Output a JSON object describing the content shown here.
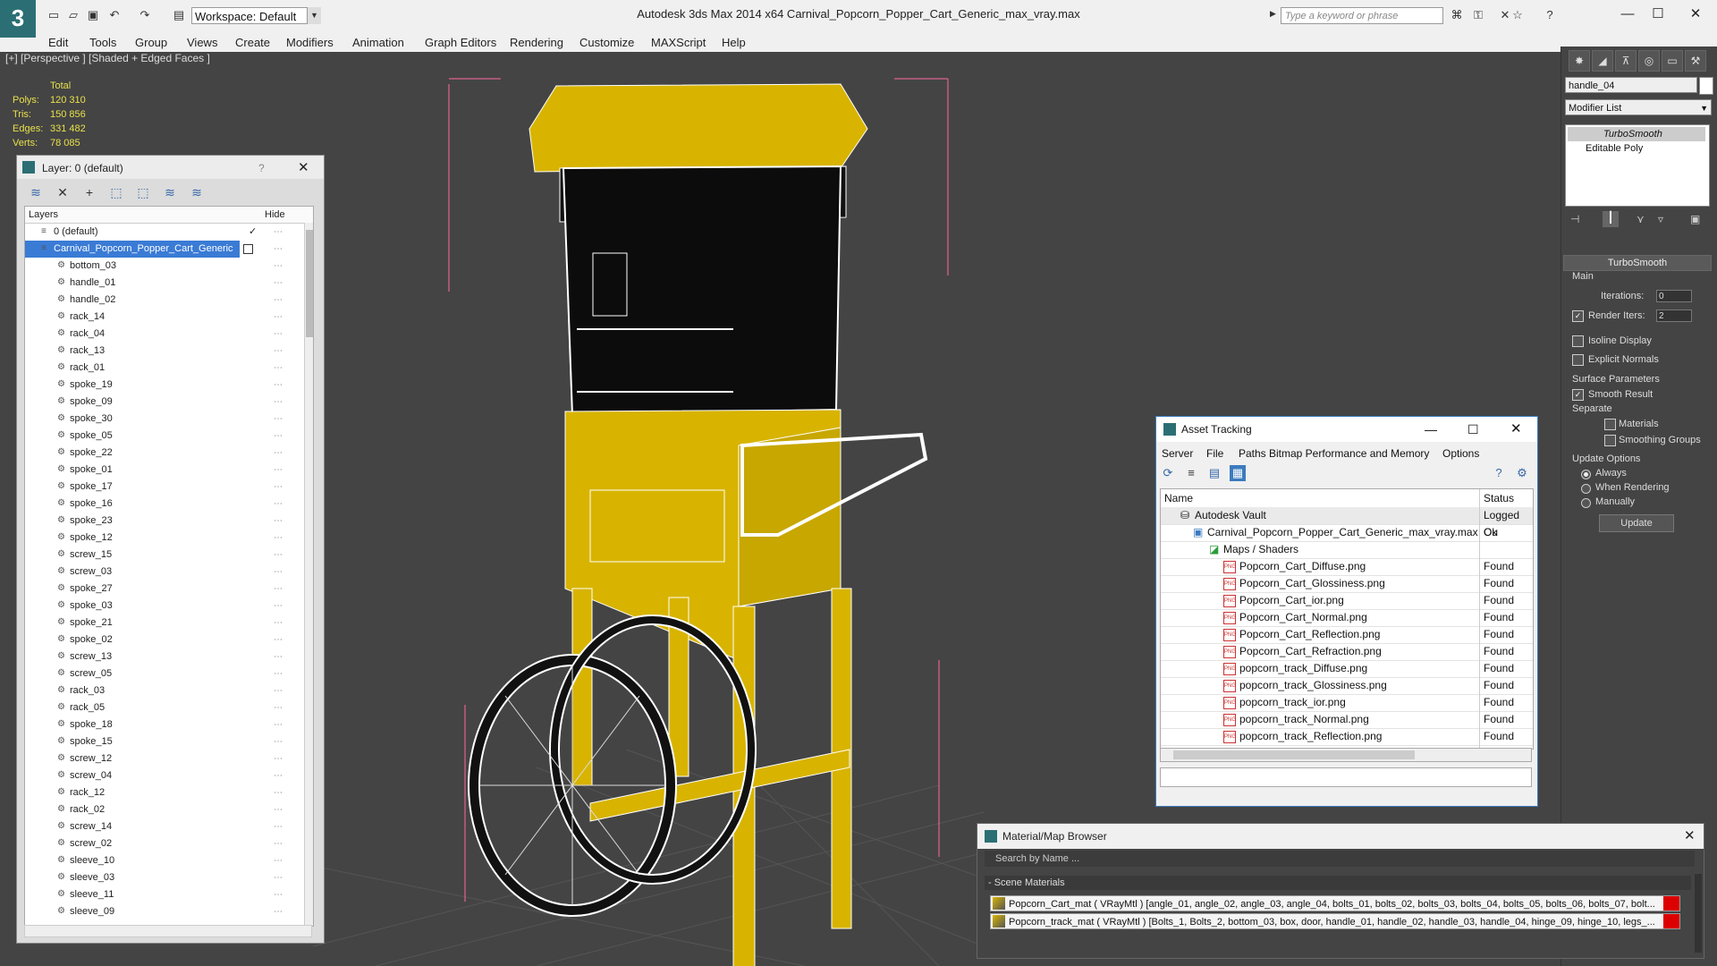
{
  "titlebar": {
    "workspace": "Workspace: Default",
    "title": "Autodesk 3ds Max  2014 x64     Carnival_Popcorn_Popper_Cart_Generic_max_vray.max",
    "search_placeholder": "Type a keyword or phrase"
  },
  "menu": [
    "Edit",
    "Tools",
    "Group",
    "Views",
    "Create",
    "Modifiers",
    "Animation",
    "Graph Editors",
    "Rendering",
    "Customize",
    "MAXScript",
    "Help"
  ],
  "viewport": {
    "label": "[+] [Perspective ] [Shaded + Edged Faces ]",
    "stats": {
      "header": "Total",
      "polys_label": "Polys:",
      "polys": "120 310",
      "tris_label": "Tris:",
      "tris": "150 856",
      "edges_label": "Edges:",
      "edges": "331 482",
      "verts_label": "Verts:",
      "verts": "78 085"
    }
  },
  "layer_dialog": {
    "title": "Layer: 0 (default)",
    "help": "?",
    "col_layers": "Layers",
    "col_hide": "Hide",
    "rows": [
      "0 (default)",
      "Carnival_Popcorn_Popper_Cart_Generic",
      "bottom_03",
      "handle_01",
      "handle_02",
      "rack_14",
      "rack_04",
      "rack_13",
      "rack_01",
      "spoke_19",
      "spoke_09",
      "spoke_30",
      "spoke_05",
      "spoke_22",
      "spoke_01",
      "spoke_17",
      "spoke_16",
      "spoke_23",
      "spoke_12",
      "screw_15",
      "screw_03",
      "spoke_27",
      "spoke_03",
      "spoke_21",
      "spoke_02",
      "screw_13",
      "screw_05",
      "rack_03",
      "rack_05",
      "spoke_18",
      "spoke_15",
      "screw_12",
      "screw_04",
      "rack_12",
      "rack_02",
      "screw_14",
      "screw_02",
      "sleeve_10",
      "sleeve_03",
      "sleeve_11",
      "sleeve_09"
    ]
  },
  "command_panel": {
    "object_name": "handle_04",
    "modifier_list": "Modifier List",
    "stack": [
      "TurboSmooth",
      "Editable Poly"
    ],
    "rollout_title": "TurboSmooth",
    "main": "Main",
    "iterations_label": "Iterations:",
    "iterations": "0",
    "render_iters_label": "Render Iters:",
    "render_iters": "2",
    "isoline": "Isoline Display",
    "explicit_normals": "Explicit Normals",
    "surface_params": "Surface Parameters",
    "smooth_result": "Smooth Result",
    "separate": "Separate",
    "materials": "Materials",
    "smoothing_groups": "Smoothing Groups",
    "update_options": "Update Options",
    "always": "Always",
    "when_rendering": "When Rendering",
    "manually": "Manually",
    "update_btn": "Update"
  },
  "asset_tracking": {
    "title": "Asset Tracking",
    "menu": [
      "Server",
      "File",
      "Paths",
      "Bitmap Performance and Memory",
      "Options"
    ],
    "col_name": "Name",
    "col_status": "Status",
    "vault": {
      "name": "Autodesk Vault",
      "status": "Logged Ou"
    },
    "file": {
      "name": "Carnival_Popcorn_Popper_Cart_Generic_max_vray.max",
      "status": "Ok"
    },
    "maps_folder": "Maps / Shaders",
    "maps": [
      {
        "name": "Popcorn_Cart_Diffuse.png",
        "status": "Found"
      },
      {
        "name": "Popcorn_Cart_Glossiness.png",
        "status": "Found"
      },
      {
        "name": "Popcorn_Cart_ior.png",
        "status": "Found"
      },
      {
        "name": "Popcorn_Cart_Normal.png",
        "status": "Found"
      },
      {
        "name": "Popcorn_Cart_Reflection.png",
        "status": "Found"
      },
      {
        "name": "Popcorn_Cart_Refraction.png",
        "status": "Found"
      },
      {
        "name": "popcorn_track_Diffuse.png",
        "status": "Found"
      },
      {
        "name": "popcorn_track_Glossiness.png",
        "status": "Found"
      },
      {
        "name": "popcorn_track_ior.png",
        "status": "Found"
      },
      {
        "name": "popcorn_track_Normal.png",
        "status": "Found"
      },
      {
        "name": "popcorn_track_Reflection.png",
        "status": "Found"
      }
    ]
  },
  "material_browser": {
    "title": "Material/Map Browser",
    "search": "Search by Name ...",
    "section": "- Scene Materials",
    "items": [
      "Popcorn_Cart_mat  ( VRayMtl )  [angle_01, angle_02, angle_03, angle_04, bolts_01, bolts_02, bolts_03, bolts_04, bolts_05, bolts_06, bolts_07, bolt...",
      "Popcorn_track_mat  ( VRayMtl )  [Bolts_1, Bolts_2, bottom_03, box, door, handle_01, handle_02, handle_03, handle_04, hinge_09, hinge_10, legs_..."
    ]
  },
  "colors": {
    "accent": "#3b7bbf",
    "model": "#d8b400",
    "stats": "#e8e04a"
  }
}
